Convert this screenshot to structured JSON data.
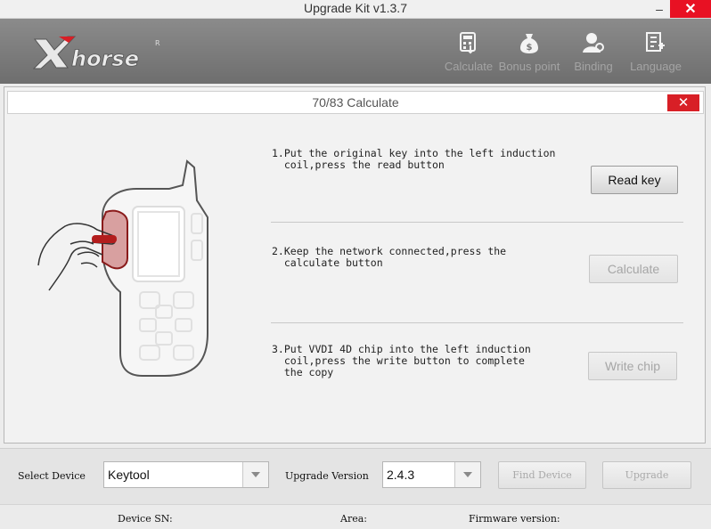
{
  "window": {
    "title": "Upgrade Kit v1.3.7",
    "minimize": "–",
    "close": "✕"
  },
  "header": {
    "brand": "Xhorse",
    "nav": [
      {
        "label": "Calculate",
        "icon": "calculator-icon"
      },
      {
        "label": "Bonus point",
        "icon": "money-bag-icon"
      },
      {
        "label": "Binding",
        "icon": "user-link-icon"
      },
      {
        "label": "Language",
        "icon": "language-icon"
      }
    ]
  },
  "dialog": {
    "title": "70/83 Calculate",
    "close": "✕",
    "steps": [
      {
        "text": "1.Put the original key into the left induction\n  coil,press the read button",
        "button": "Read key",
        "enabled": true
      },
      {
        "text": "2.Keep the network connected,press the\n  calculate button",
        "button": "Calculate",
        "enabled": false
      },
      {
        "text": "3.Put VVDI 4D chip into the left induction\n  coil,press the write button to complete\n  the copy",
        "button": "Write chip",
        "enabled": false
      }
    ]
  },
  "bottom": {
    "select_device_label": "Select Device",
    "device_value": "Keytool",
    "upgrade_version_label": "Upgrade Version",
    "version_value": "2.4.3",
    "find_device": "Find Device",
    "upgrade": "Upgrade"
  },
  "status": {
    "device_sn": "Device SN:",
    "area": "Area:",
    "firmware": "Firmware version:"
  },
  "colors": {
    "accent_red": "#d81f26",
    "header_gray": "#7a7a7a"
  }
}
